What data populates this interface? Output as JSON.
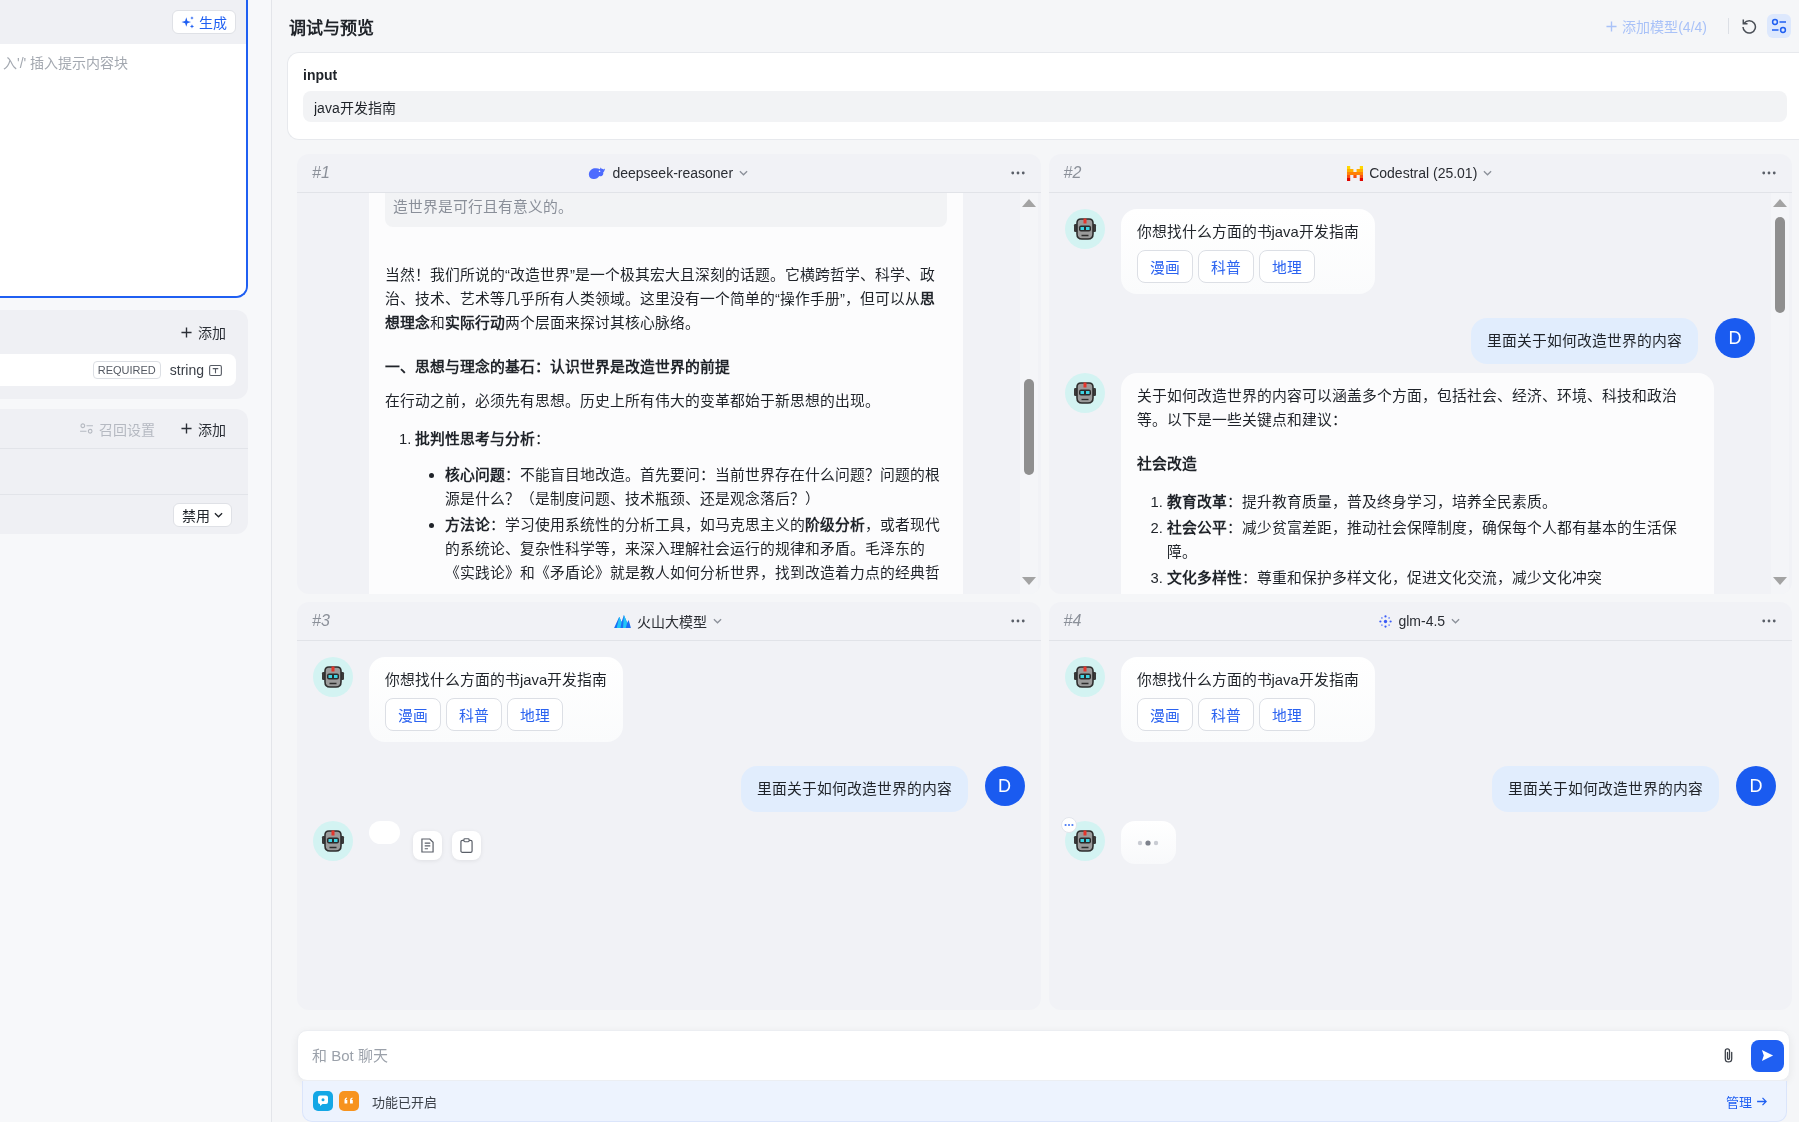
{
  "left_panel": {
    "prompt_editor": {
      "generate_button": "生成",
      "placeholder": "入'/' 插入提示内容块"
    },
    "variables": {
      "add_button": "添加",
      "row": {
        "required_badge": "REQUIRED",
        "type": "string"
      }
    },
    "knowledge": {
      "recall_settings": {
        "label": "召回设置",
        "disabled": true
      },
      "add_button": "添加",
      "mode_select": "禁用"
    }
  },
  "header": {
    "title": "调试与预览",
    "add_model_button": {
      "label": "添加模型(4/4)",
      "disabled": true
    },
    "settings_button": {
      "selected": true
    }
  },
  "input_card": {
    "label": "input",
    "value": "java开发指南"
  },
  "panels": [
    {
      "number": "#1",
      "model": {
        "name": "deepseek-reasoner",
        "kind": "whale"
      },
      "scrollbar": true,
      "messages": [
        {
          "kind": "bot",
          "avatar": false,
          "blocks": [
            {
              "kind": "reasoning",
              "text": "造世界是可行且有意义的。"
            },
            {
              "kind": "paragraph",
              "text": "当然！我们所说的“改造世界”是一个极其宏大且深刻的话题。它横跨哲学、科学、政治、技术、艺术等几乎所有人类领域。这里没有一个简单的“操作手册”，但可以从**思想理念**和**实际行动**两个层面来探讨其核心脉络。"
            },
            {
              "kind": "heading",
              "text": "一、思想与理念的基石：认识世界是改造世界的前提"
            },
            {
              "kind": "paragraph",
              "text": "在行动之前，必须先有思想。历史上所有伟大的变革都始于新思想的出现。"
            },
            {
              "kind": "list_item",
              "marker": "1.",
              "text": "**批判性思考与分析**：",
              "children": [
                {
                  "text": "**核心问题**：不能盲目地改造。首先要问：当前世界存在什么问题？问题的根源是什么？（是制度问题、技术瓶颈、还是观念落后？）"
                },
                {
                  "text": "**方法论**：学习使用系统性的分析工具，如马克思主义的**阶级分析**，或者现代的系统论、复杂性科学等，来深入理解社会运行的规律和矛盾。毛泽东的《实践论》和《矛盾论》就是教人如何分析世界，找到改造着力点的经典哲"
                }
              ]
            }
          ]
        }
      ]
    },
    {
      "number": "#2",
      "model": {
        "name": "Codestral (25.01)",
        "kind": "blocks"
      },
      "scrollbar": true,
      "messages": [
        {
          "kind": "bot",
          "avatar": true,
          "text": "你想找什么方面的书java开发指南",
          "options": [
            "漫画",
            "科普",
            "地理"
          ]
        },
        {
          "kind": "user",
          "avatar_letter": "D",
          "text": "里面关于如何改造世界的内容"
        },
        {
          "kind": "bot",
          "avatar": true,
          "blocks": [
            {
              "kind": "paragraph",
              "text": "关于如何改造世界的内容可以涵盖多个方面，包括社会、经济、环境、科技和政治等。以下是一些关键点和建议："
            },
            {
              "kind": "heading",
              "text": "社会改造"
            },
            {
              "kind": "list_item",
              "marker": "1.",
              "text": "**教育改革**：提升教育质量，普及终身学习，培养全民素质。"
            },
            {
              "kind": "list_item",
              "marker": "2.",
              "text": "**社会公平**：减少贫富差距，推动社会保障制度，确保每个人都有基本的生活保障。"
            },
            {
              "kind": "list_item",
              "marker": "3.",
              "text": "**文化多样性**：尊重和保护多样文化，促进文化交流，减少文化冲突"
            }
          ]
        }
      ]
    },
    {
      "number": "#3",
      "model": {
        "name": "火山大模型",
        "kind": "peaks"
      },
      "scrollbar": false,
      "messages": [
        {
          "kind": "bot",
          "avatar": true,
          "text": "你想找什么方面的书java开发指南",
          "options": [
            "漫画",
            "科普",
            "地理"
          ]
        },
        {
          "kind": "user",
          "avatar_letter": "D",
          "text": "里面关于如何改造世界的内容"
        },
        {
          "kind": "bot_pending",
          "avatar": true
        }
      ]
    },
    {
      "number": "#4",
      "model": {
        "name": "glm-4.5",
        "kind": "star"
      },
      "scrollbar": false,
      "messages": [
        {
          "kind": "bot",
          "avatar": true,
          "text": "你想找什么方面的书java开发指南",
          "options": [
            "漫画",
            "科普",
            "地理"
          ]
        },
        {
          "kind": "user",
          "avatar_letter": "D",
          "text": "里面关于如何改造世界的内容"
        },
        {
          "kind": "bot_typing",
          "avatar": true
        }
      ]
    }
  ],
  "composer": {
    "placeholder": "和 Bot 聊天"
  },
  "feature_bar": {
    "status": "功能已开启",
    "manage_link": "管理"
  }
}
